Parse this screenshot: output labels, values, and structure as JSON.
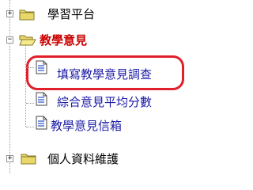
{
  "tree": {
    "nodes": [
      {
        "label": "學習平台",
        "icon": "folder-closed-icon",
        "expander": "+"
      },
      {
        "label": "教學意見",
        "icon": "folder-open-icon",
        "expander": "−"
      },
      {
        "label": "填寫教學意見調查",
        "icon": "document-icon"
      },
      {
        "label": "綜合意見平均分數",
        "icon": "document-icon"
      },
      {
        "label": "教學意見信箱",
        "icon": "document-icon"
      },
      {
        "label": "個人資料維護",
        "icon": "folder-closed-icon",
        "expander": "+"
      }
    ]
  },
  "colors": {
    "active_section": "#cc0000",
    "link": "#1a1aa6",
    "highlight_ring": "#e0202a",
    "folder_fill": "#e8d86a"
  }
}
